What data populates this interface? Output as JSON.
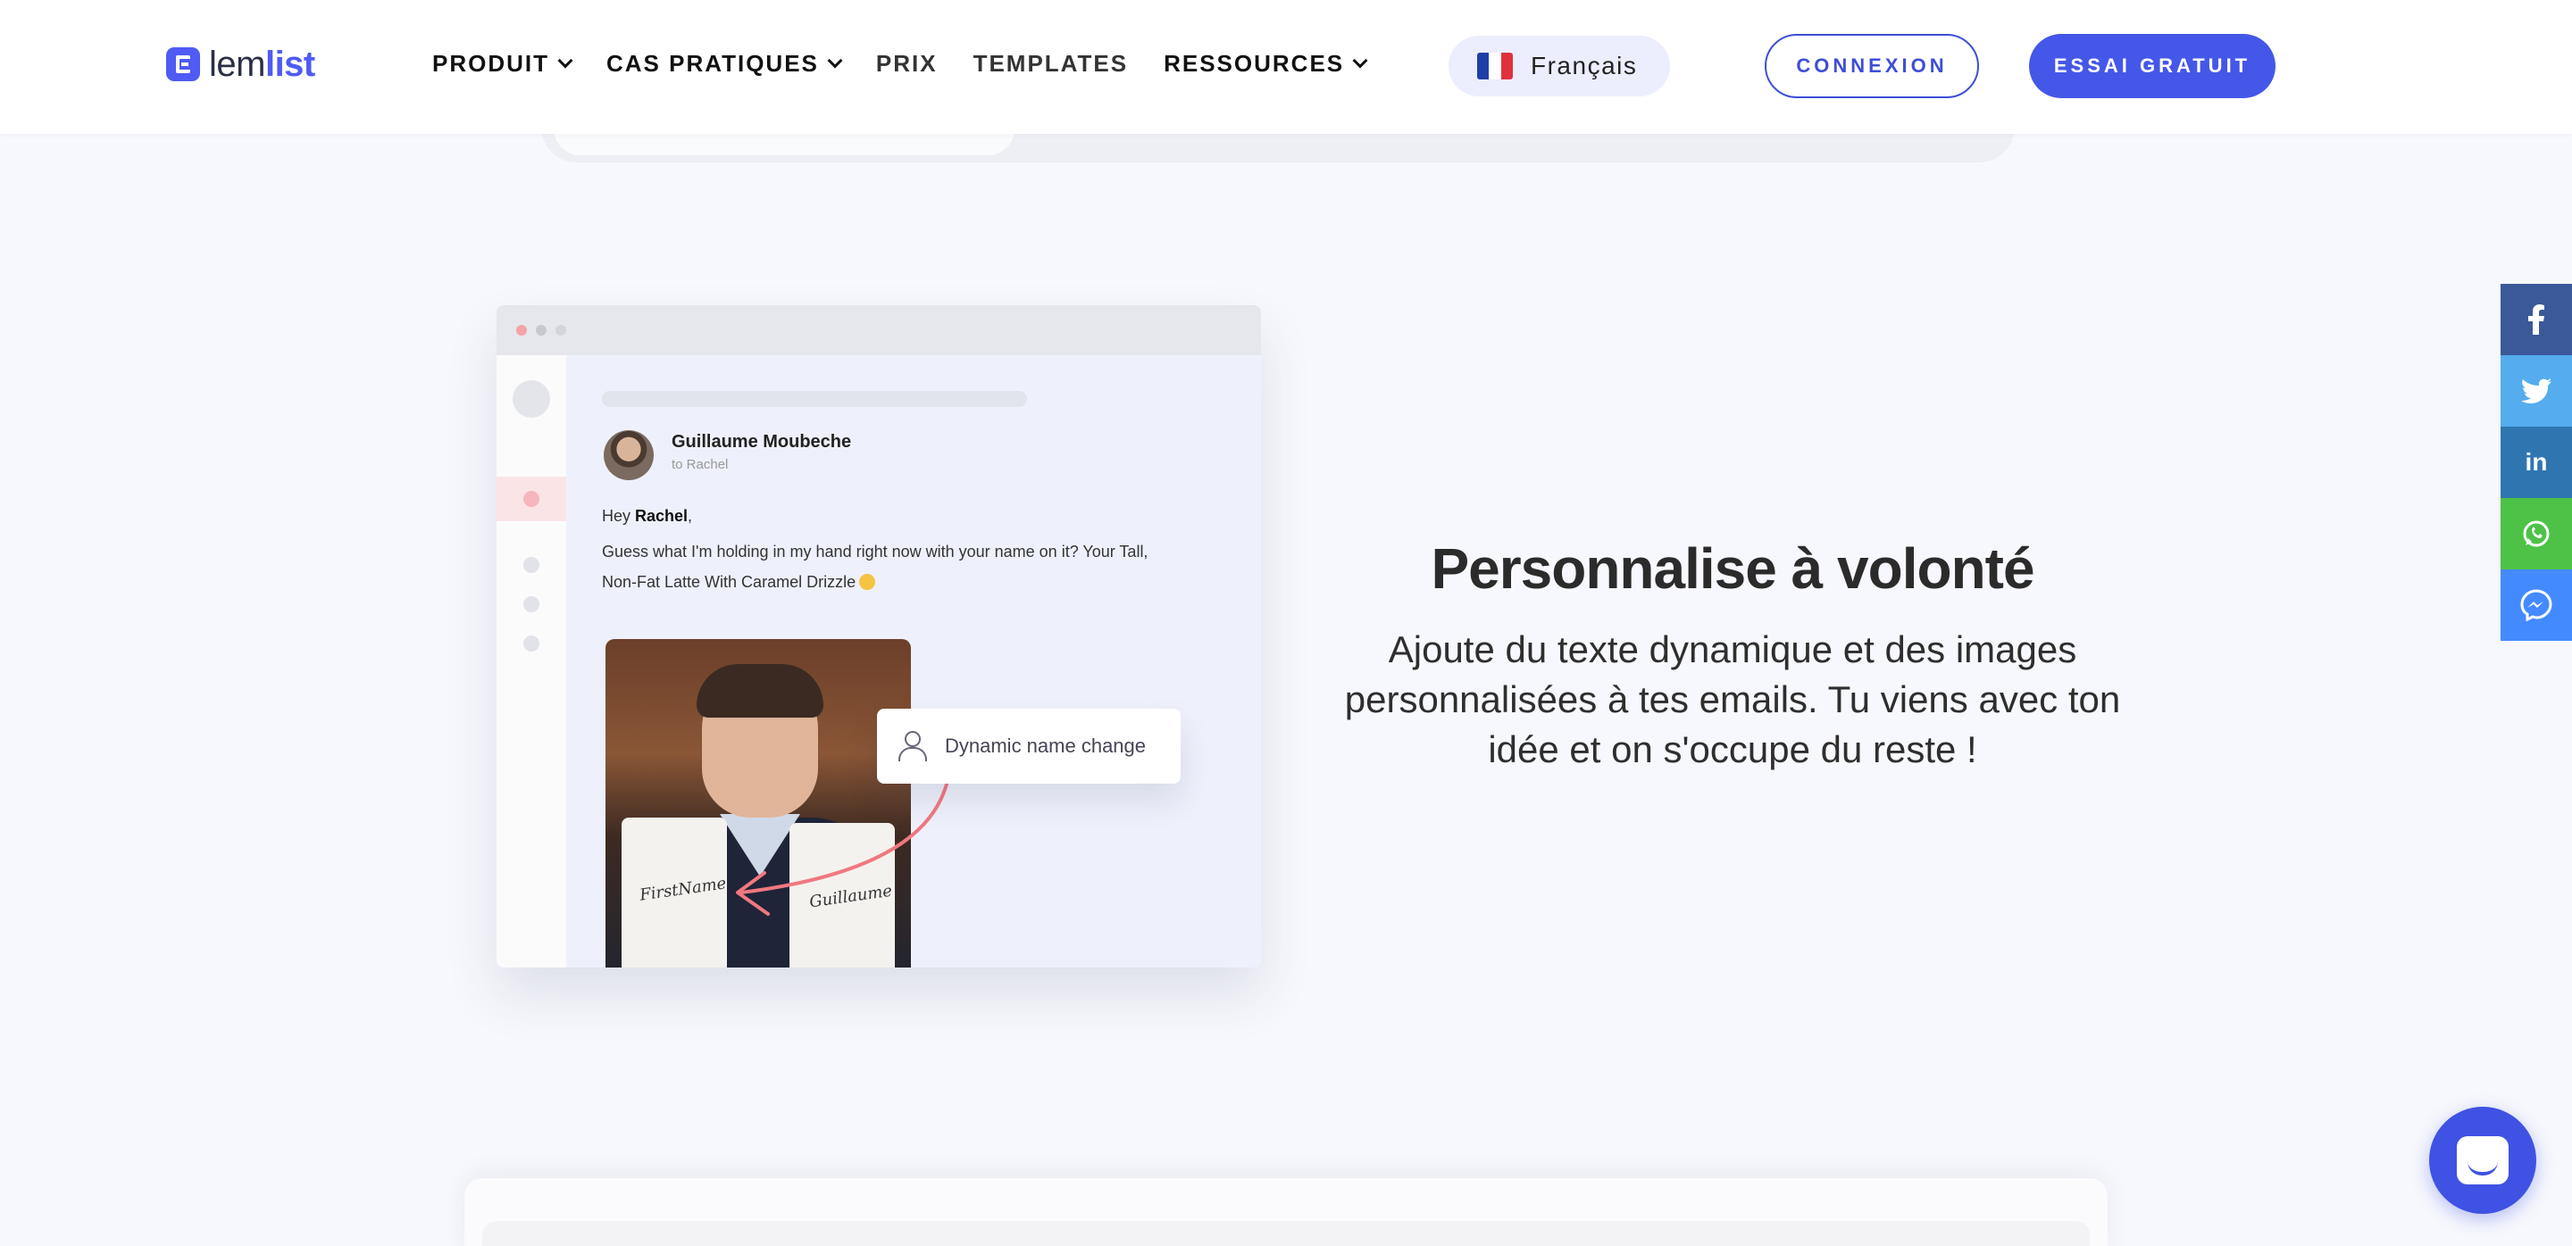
{
  "nav": {
    "logo": {
      "prefix": "lem",
      "suffix": "list"
    },
    "items": [
      {
        "label": "PRODUIT",
        "has_dropdown": true
      },
      {
        "label": "CAS PRATIQUES",
        "has_dropdown": true
      },
      {
        "label": "PRIX",
        "has_dropdown": false
      },
      {
        "label": "TEMPLATES",
        "has_dropdown": false
      },
      {
        "label": "RESSOURCES",
        "has_dropdown": true
      }
    ],
    "language": "Français",
    "login_label": "CONNEXION",
    "trial_label": "ESSAI GRATUIT"
  },
  "mockup": {
    "sender": "Guillaume Moubeche",
    "recipient": "to Rachel",
    "greeting_prefix": "Hey ",
    "greeting_name": "Rachel",
    "greeting_suffix": ",",
    "body_line1": "Guess what I'm holding in my hand right now with your name on it? Your Tall,",
    "body_line2": "Non-Fat Latte With Caramel Drizzle",
    "tooltip": "Dynamic name change",
    "cup_left": "FirstName",
    "cup_right": "Guillaume"
  },
  "feature": {
    "title": "Personnalise à volonté",
    "description": "Ajoute du texte dynamique et des images personnalisées à tes emails. Tu viens avec ton idée et on s'occupe du reste !"
  },
  "social": [
    {
      "name": "facebook",
      "glyph": "f",
      "color": "#3b5998"
    },
    {
      "name": "twitter",
      "glyph": "t",
      "color": "#55acee"
    },
    {
      "name": "linkedin",
      "glyph": "in",
      "color": "#2f76b1"
    },
    {
      "name": "whatsapp",
      "glyph": "w",
      "color": "#4dc247"
    },
    {
      "name": "messenger",
      "glyph": "m",
      "color": "#448aff"
    }
  ],
  "colors": {
    "brand": "#4f5bf3",
    "button": "#4557e8",
    "background": "#f7f8fd"
  }
}
